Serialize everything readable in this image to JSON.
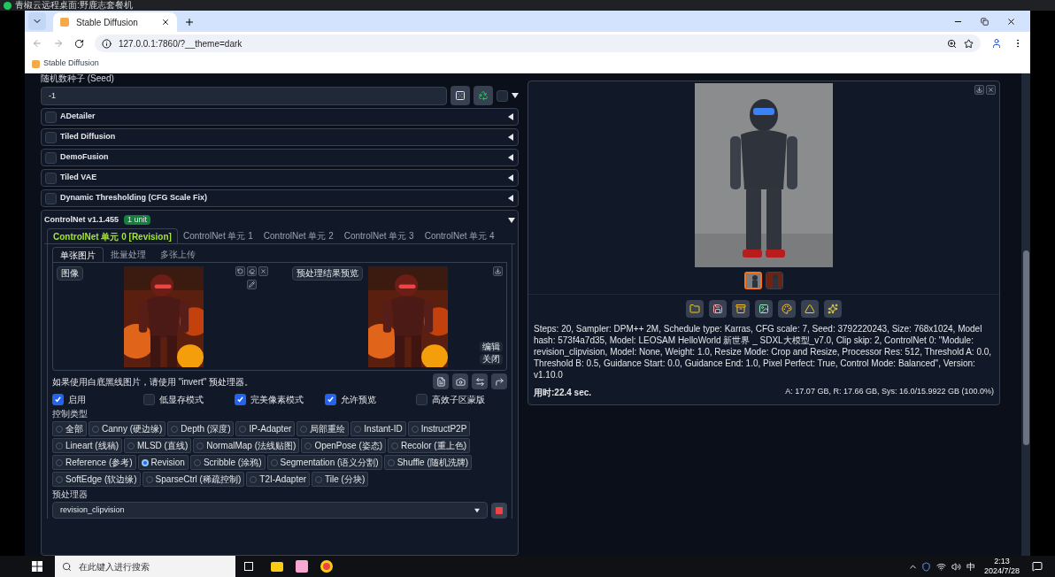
{
  "remote_bar": {
    "title": "青椒云远程桌面:野鹿志套餐机"
  },
  "browser": {
    "tab_title": "Stable Diffusion",
    "url": "127.0.0.1:7860/?__theme=dark",
    "bookmark": "Stable Diffusion"
  },
  "seed": {
    "label": "随机数种子 (Seed)",
    "value": "-1",
    "extra_checked": false
  },
  "accordions": [
    {
      "label": "ADetailer",
      "checked": false
    },
    {
      "label": "Tiled Diffusion",
      "checked": false
    },
    {
      "label": "DemoFusion",
      "checked": false
    },
    {
      "label": "Tiled VAE",
      "checked": false
    },
    {
      "label": "Dynamic Thresholding (CFG Scale Fix)",
      "checked": false
    }
  ],
  "controlnet": {
    "title": "ControlNet v1.1.455",
    "badge": "1 unit",
    "expanded": true,
    "unit_tabs": [
      {
        "label": "ControlNet 单元 0 [Revision]",
        "selected": true
      },
      {
        "label": "ControlNet 单元 1",
        "selected": false
      },
      {
        "label": "ControlNet 单元 2",
        "selected": false
      },
      {
        "label": "ControlNet 单元 3",
        "selected": false
      },
      {
        "label": "ControlNet 单元 4",
        "selected": false
      }
    ],
    "input_tabs": [
      {
        "label": "单张图片",
        "selected": true
      },
      {
        "label": "批量处理",
        "selected": false
      },
      {
        "label": "多张上传",
        "selected": false
      }
    ],
    "image_label": "图像",
    "preview_label": "预处理结果预览",
    "edit": "编辑",
    "close": "关闭",
    "hint": "如果使用白底黑线图片，请使用 \"invert\" 预处理器。",
    "options": [
      {
        "label": "启用",
        "checked": true
      },
      {
        "label": "低显存模式",
        "checked": false
      },
      {
        "label": "完美像素模式",
        "checked": true
      },
      {
        "label": "允许预览",
        "checked": true
      },
      {
        "label": "高效子区蒙版",
        "checked": false
      }
    ],
    "control_type_label": "控制类型",
    "control_types": [
      {
        "label": "全部",
        "selected": false
      },
      {
        "label": "Canny (硬边缘)",
        "selected": false
      },
      {
        "label": "Depth (深度)",
        "selected": false
      },
      {
        "label": "IP-Adapter",
        "selected": false
      },
      {
        "label": "局部重绘",
        "selected": false
      },
      {
        "label": "Instant-ID",
        "selected": false
      },
      {
        "label": "InstructP2P",
        "selected": false
      },
      {
        "label": "Lineart (线稿)",
        "selected": false
      },
      {
        "label": "MLSD (直线)",
        "selected": false
      },
      {
        "label": "NormalMap (法线贴图)",
        "selected": false
      },
      {
        "label": "OpenPose (姿态)",
        "selected": false
      },
      {
        "label": "Recolor (重上色)",
        "selected": false
      },
      {
        "label": "Reference (参考)",
        "selected": false
      },
      {
        "label": "Revision",
        "selected": true
      },
      {
        "label": "Scribble (涂鸦)",
        "selected": false
      },
      {
        "label": "Segmentation (语义分割)",
        "selected": false
      },
      {
        "label": "Shuffle (随机洗牌)",
        "selected": false
      },
      {
        "label": "SoftEdge (软边缘)",
        "selected": false
      },
      {
        "label": "SparseCtrl (稀疏控制)",
        "selected": false
      },
      {
        "label": "T2I-Adapter",
        "selected": false
      },
      {
        "label": "Tile (分块)",
        "selected": false
      }
    ],
    "preprocessor_label": "预处理器",
    "preprocessor": "revision_clipvision"
  },
  "output": {
    "thumbnails": [
      {
        "selected": true
      },
      {
        "selected": false
      }
    ],
    "info": "Steps: 20, Sampler: DPM++ 2M, Schedule type: Karras, CFG scale: 7, Seed: 3792220243, Size: 768x1024, Model hash: 573f4a7d35, Model: LEOSAM HelloWorld 新世界 _ SDXL大模型_v7.0, Clip skip: 2, ControlNet 0: \"Module: revision_clipvision, Model: None, Weight: 1.0, Resize Mode: Crop and Resize, Processor Res: 512, Threshold A: 0.0, Threshold B: 0.5, Guidance Start: 0.0, Guidance End: 1.0, Pixel Perfect: True, Control Mode: Balanced\", Version: v1.10.0",
    "time": "用时:22.4 sec.",
    "memory": "A: 17.07 GB, R: 17.66 GB, Sys: 16.0/15.9922 GB (100.0%)"
  },
  "taskbar": {
    "search_placeholder": "在此键入进行搜索",
    "ime": "中",
    "time": "2:13",
    "date": "2024/7/28"
  }
}
